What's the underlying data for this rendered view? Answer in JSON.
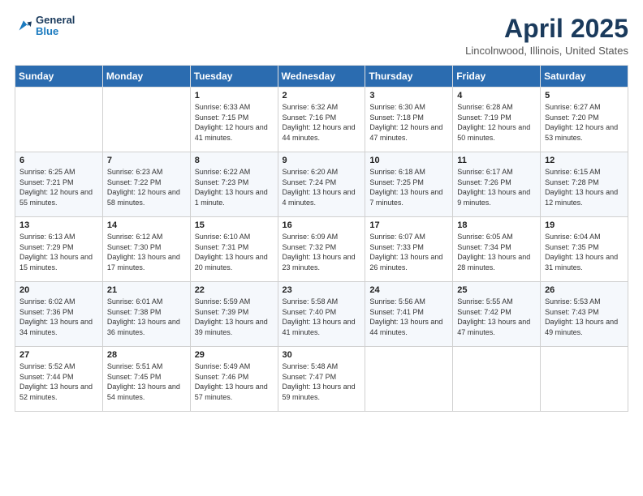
{
  "header": {
    "logo_line1": "General",
    "logo_line2": "Blue",
    "title": "April 2025",
    "subtitle": "Lincolnwood, Illinois, United States"
  },
  "days_of_week": [
    "Sunday",
    "Monday",
    "Tuesday",
    "Wednesday",
    "Thursday",
    "Friday",
    "Saturday"
  ],
  "weeks": [
    [
      {
        "day": "",
        "info": ""
      },
      {
        "day": "",
        "info": ""
      },
      {
        "day": "1",
        "info": "Sunrise: 6:33 AM\nSunset: 7:15 PM\nDaylight: 12 hours and 41 minutes."
      },
      {
        "day": "2",
        "info": "Sunrise: 6:32 AM\nSunset: 7:16 PM\nDaylight: 12 hours and 44 minutes."
      },
      {
        "day": "3",
        "info": "Sunrise: 6:30 AM\nSunset: 7:18 PM\nDaylight: 12 hours and 47 minutes."
      },
      {
        "day": "4",
        "info": "Sunrise: 6:28 AM\nSunset: 7:19 PM\nDaylight: 12 hours and 50 minutes."
      },
      {
        "day": "5",
        "info": "Sunrise: 6:27 AM\nSunset: 7:20 PM\nDaylight: 12 hours and 53 minutes."
      }
    ],
    [
      {
        "day": "6",
        "info": "Sunrise: 6:25 AM\nSunset: 7:21 PM\nDaylight: 12 hours and 55 minutes."
      },
      {
        "day": "7",
        "info": "Sunrise: 6:23 AM\nSunset: 7:22 PM\nDaylight: 12 hours and 58 minutes."
      },
      {
        "day": "8",
        "info": "Sunrise: 6:22 AM\nSunset: 7:23 PM\nDaylight: 13 hours and 1 minute."
      },
      {
        "day": "9",
        "info": "Sunrise: 6:20 AM\nSunset: 7:24 PM\nDaylight: 13 hours and 4 minutes."
      },
      {
        "day": "10",
        "info": "Sunrise: 6:18 AM\nSunset: 7:25 PM\nDaylight: 13 hours and 7 minutes."
      },
      {
        "day": "11",
        "info": "Sunrise: 6:17 AM\nSunset: 7:26 PM\nDaylight: 13 hours and 9 minutes."
      },
      {
        "day": "12",
        "info": "Sunrise: 6:15 AM\nSunset: 7:28 PM\nDaylight: 13 hours and 12 minutes."
      }
    ],
    [
      {
        "day": "13",
        "info": "Sunrise: 6:13 AM\nSunset: 7:29 PM\nDaylight: 13 hours and 15 minutes."
      },
      {
        "day": "14",
        "info": "Sunrise: 6:12 AM\nSunset: 7:30 PM\nDaylight: 13 hours and 17 minutes."
      },
      {
        "day": "15",
        "info": "Sunrise: 6:10 AM\nSunset: 7:31 PM\nDaylight: 13 hours and 20 minutes."
      },
      {
        "day": "16",
        "info": "Sunrise: 6:09 AM\nSunset: 7:32 PM\nDaylight: 13 hours and 23 minutes."
      },
      {
        "day": "17",
        "info": "Sunrise: 6:07 AM\nSunset: 7:33 PM\nDaylight: 13 hours and 26 minutes."
      },
      {
        "day": "18",
        "info": "Sunrise: 6:05 AM\nSunset: 7:34 PM\nDaylight: 13 hours and 28 minutes."
      },
      {
        "day": "19",
        "info": "Sunrise: 6:04 AM\nSunset: 7:35 PM\nDaylight: 13 hours and 31 minutes."
      }
    ],
    [
      {
        "day": "20",
        "info": "Sunrise: 6:02 AM\nSunset: 7:36 PM\nDaylight: 13 hours and 34 minutes."
      },
      {
        "day": "21",
        "info": "Sunrise: 6:01 AM\nSunset: 7:38 PM\nDaylight: 13 hours and 36 minutes."
      },
      {
        "day": "22",
        "info": "Sunrise: 5:59 AM\nSunset: 7:39 PM\nDaylight: 13 hours and 39 minutes."
      },
      {
        "day": "23",
        "info": "Sunrise: 5:58 AM\nSunset: 7:40 PM\nDaylight: 13 hours and 41 minutes."
      },
      {
        "day": "24",
        "info": "Sunrise: 5:56 AM\nSunset: 7:41 PM\nDaylight: 13 hours and 44 minutes."
      },
      {
        "day": "25",
        "info": "Sunrise: 5:55 AM\nSunset: 7:42 PM\nDaylight: 13 hours and 47 minutes."
      },
      {
        "day": "26",
        "info": "Sunrise: 5:53 AM\nSunset: 7:43 PM\nDaylight: 13 hours and 49 minutes."
      }
    ],
    [
      {
        "day": "27",
        "info": "Sunrise: 5:52 AM\nSunset: 7:44 PM\nDaylight: 13 hours and 52 minutes."
      },
      {
        "day": "28",
        "info": "Sunrise: 5:51 AM\nSunset: 7:45 PM\nDaylight: 13 hours and 54 minutes."
      },
      {
        "day": "29",
        "info": "Sunrise: 5:49 AM\nSunset: 7:46 PM\nDaylight: 13 hours and 57 minutes."
      },
      {
        "day": "30",
        "info": "Sunrise: 5:48 AM\nSunset: 7:47 PM\nDaylight: 13 hours and 59 minutes."
      },
      {
        "day": "",
        "info": ""
      },
      {
        "day": "",
        "info": ""
      },
      {
        "day": "",
        "info": ""
      }
    ]
  ]
}
